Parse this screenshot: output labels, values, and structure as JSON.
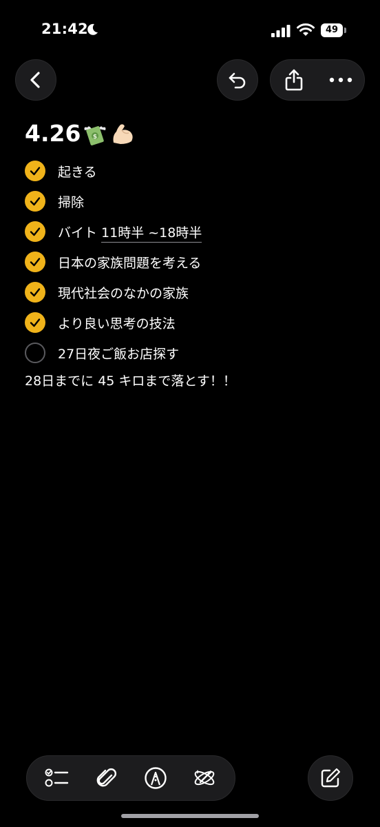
{
  "status_bar": {
    "time": "21:42",
    "battery_level": "49",
    "icons": [
      "moon-icon",
      "signal-icon",
      "wifi-icon",
      "battery-icon"
    ]
  },
  "nav": {
    "icons": [
      "chevron-left-icon",
      "undo-icon",
      "share-icon",
      "more-icon"
    ]
  },
  "note": {
    "title": "4.26",
    "title_emojis": [
      "money-with-wings-icon",
      "flexed-biceps-icon"
    ],
    "checklist": [
      {
        "text": "起きる",
        "done": true
      },
      {
        "text": "掃除",
        "done": true
      },
      {
        "text_prefix": "バイト ",
        "text_linked": "11時半 ~18時半",
        "done": true
      },
      {
        "text": "日本の家族問題を考える",
        "done": true
      },
      {
        "text": "現代社会のなかの家族",
        "done": true
      },
      {
        "text": "より良い思考の技法",
        "done": true
      },
      {
        "text": "27日夜ご飯お店探す",
        "done": false
      }
    ],
    "plain_line": "28日までに 45 キロまで落とす！！"
  },
  "colors": {
    "background": "#000000",
    "accent_check": "#f0b31a",
    "button_bg": "#1c1c1e"
  },
  "toolbar": {
    "icons": [
      "checklist-icon",
      "paperclip-icon",
      "markup-pen-icon",
      "writing-tools-icon",
      "compose-icon"
    ]
  }
}
